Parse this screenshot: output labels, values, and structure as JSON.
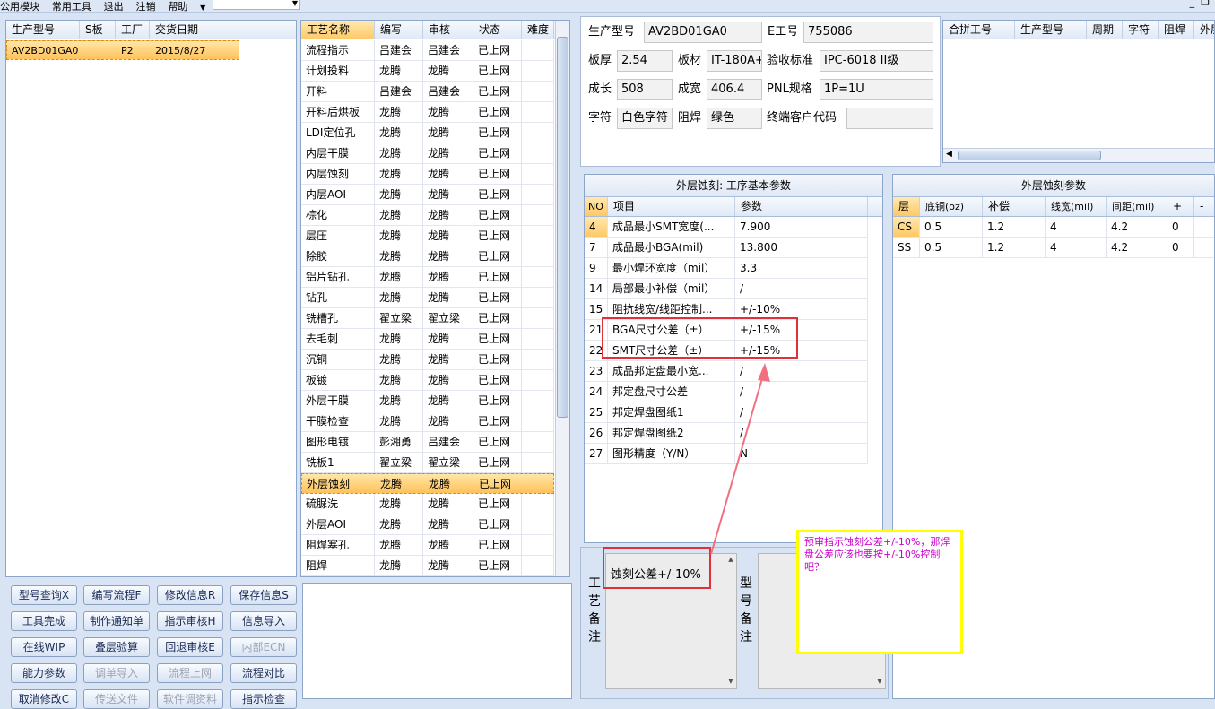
{
  "menu": {
    "items": [
      "公用模块",
      "常用工具",
      "退出",
      "注销",
      "帮助"
    ],
    "combo_value": ""
  },
  "left_table": {
    "headers": [
      "生产型号",
      "S板",
      "工厂",
      "交货日期"
    ],
    "rows": [
      {
        "model": "AV2BD01GA0",
        "s": "",
        "factory": "P2",
        "date": "2015/8/27"
      }
    ]
  },
  "process_table": {
    "headers": [
      "工艺名称",
      "编写",
      "审核",
      "状态",
      "难度"
    ],
    "rows": [
      [
        "流程指示",
        "吕建会",
        "吕建会",
        "已上网"
      ],
      [
        "计划投料",
        "龙腾",
        "龙腾",
        "已上网"
      ],
      [
        "开料",
        "吕建会",
        "吕建会",
        "已上网"
      ],
      [
        "开料后烘板",
        "龙腾",
        "龙腾",
        "已上网"
      ],
      [
        "LDI定位孔",
        "龙腾",
        "龙腾",
        "已上网"
      ],
      [
        "内层干膜",
        "龙腾",
        "龙腾",
        "已上网"
      ],
      [
        "内层蚀刻",
        "龙腾",
        "龙腾",
        "已上网"
      ],
      [
        "内层AOI",
        "龙腾",
        "龙腾",
        "已上网"
      ],
      [
        "棕化",
        "龙腾",
        "龙腾",
        "已上网"
      ],
      [
        "层压",
        "龙腾",
        "龙腾",
        "已上网"
      ],
      [
        "除胶",
        "龙腾",
        "龙腾",
        "已上网"
      ],
      [
        "铝片钻孔",
        "龙腾",
        "龙腾",
        "已上网"
      ],
      [
        "钻孔",
        "龙腾",
        "龙腾",
        "已上网"
      ],
      [
        "铣槽孔",
        "翟立梁",
        "翟立梁",
        "已上网"
      ],
      [
        "去毛刺",
        "龙腾",
        "龙腾",
        "已上网"
      ],
      [
        "沉铜",
        "龙腾",
        "龙腾",
        "已上网"
      ],
      [
        "板镀",
        "龙腾",
        "龙腾",
        "已上网"
      ],
      [
        "外层干膜",
        "龙腾",
        "龙腾",
        "已上网"
      ],
      [
        "干膜检查",
        "龙腾",
        "龙腾",
        "已上网"
      ],
      [
        "图形电镀",
        "彭湘勇",
        "吕建会",
        "已上网"
      ],
      [
        "铣板1",
        "翟立梁",
        "翟立梁",
        "已上网"
      ],
      [
        "外层蚀刻",
        "龙腾",
        "龙腾",
        "已上网"
      ],
      [
        "硫脲洗",
        "龙腾",
        "龙腾",
        "已上网"
      ],
      [
        "外层AOI",
        "龙腾",
        "龙腾",
        "已上网"
      ],
      [
        "阻焊塞孔",
        "龙腾",
        "龙腾",
        "已上网"
      ],
      [
        "阻焊",
        "龙腾",
        "龙腾",
        "已上网"
      ]
    ],
    "selected_index": 21
  },
  "buttons": [
    [
      "型号查询X",
      "编写流程F",
      "修改信息R",
      "保存信息S"
    ],
    [
      "工具完成",
      "制作通知单",
      "指示审核H",
      "信息导入"
    ],
    [
      "在线WIP",
      "叠层验算",
      "回退审核E",
      "内部ECN"
    ],
    [
      "能力参数",
      "调单导入",
      "流程上网",
      "流程对比"
    ],
    [
      "取消修改C",
      "传送文件",
      "软件调资料",
      "指示检查"
    ]
  ],
  "disabled_buttons": [
    "内部ECN",
    "调单导入",
    "流程上网",
    "传送文件",
    "软件调资料"
  ],
  "info": {
    "model_label": "生产型号",
    "model_value": "AV2BD01GA0",
    "e_label": "E工号",
    "e_value": "755086",
    "thick_label": "板厚",
    "thick_value": "2.54",
    "material_label": "板材",
    "material_value": "IT-180A+",
    "standard_label": "验收标准",
    "standard_value": "IPC-6018 II级",
    "len_label": "成长",
    "len_value": "508",
    "wid_label": "成宽",
    "wid_value": "406.4",
    "pnl_label": "PNL规格",
    "pnl_value": "1P=1U",
    "char_label": "字符",
    "char_value": "白色字符",
    "mask_label": "阻焊",
    "mask_value": "绿色",
    "customer_label": "终端客户代码",
    "customer_value": ""
  },
  "merge_table": {
    "headers": [
      "合拼工号",
      "生产型号",
      "周期",
      "字符",
      "阻焊",
      "外层"
    ]
  },
  "basic_params": {
    "title": "外层蚀刻: 工序基本参数",
    "headers": [
      "NO",
      "项目",
      "参数"
    ],
    "rows": [
      [
        "4",
        "成品最小SMT宽度(...",
        "7.900"
      ],
      [
        "7",
        "成品最小BGA(mil)",
        "13.800"
      ],
      [
        "9",
        "最小焊环宽度（mil）",
        "3.3"
      ],
      [
        "14",
        "局部最小补偿（mil）",
        "/"
      ],
      [
        "15",
        "阻抗线宽/线距控制...",
        "+/-10%"
      ],
      [
        "21",
        "BGA尺寸公差（±）",
        "+/-15%"
      ],
      [
        "22",
        "SMT尺寸公差（±）",
        "+/-15%"
      ],
      [
        "23",
        "成品邦定盘最小宽...",
        "/"
      ],
      [
        "24",
        "邦定盘尺寸公差",
        "/"
      ],
      [
        "25",
        "邦定焊盘图纸1",
        "/"
      ],
      [
        "26",
        "邦定焊盘图纸2",
        "/"
      ],
      [
        "27",
        "图形精度（Y/N）",
        "N"
      ]
    ]
  },
  "etch_params": {
    "title": "外层蚀刻参数",
    "headers": [
      "层",
      "底铜(oz)",
      "补偿",
      "线宽(mil)",
      "间距(mil)",
      "+",
      "-"
    ],
    "rows": [
      [
        "CS",
        "0.5",
        "1.2",
        "4",
        "4.2",
        "0"
      ],
      [
        "SS",
        "0.5",
        "1.2",
        "4",
        "4.2",
        "0"
      ]
    ]
  },
  "notes": {
    "process_label": "工艺备注",
    "process_text": "蚀刻公差+/-10%",
    "model_label": "型号备注",
    "model_text": ""
  },
  "annotation": {
    "text": "预审指示蚀刻公差+/-10%，那焊盘公差应该也要按+/-10%控制吧？",
    "border_color": "#ffff00",
    "text_color": "#cc00cc",
    "arrow_color": "#f07080"
  }
}
